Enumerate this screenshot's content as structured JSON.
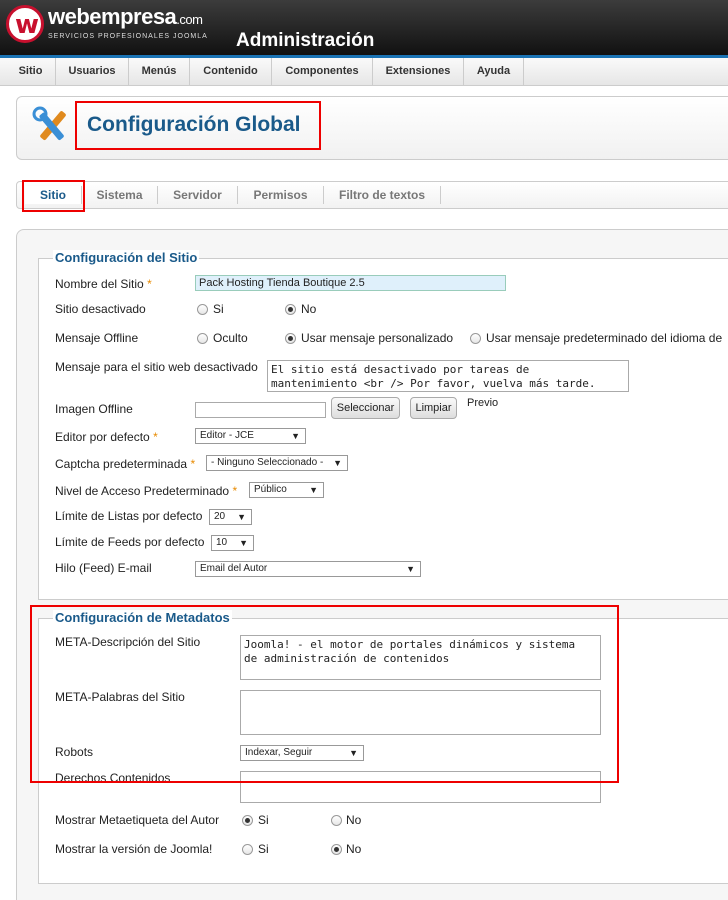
{
  "header": {
    "brand": "webempresa",
    "brand_suffix": ".com",
    "tagline": "SERVICIOS PROFESIONALES JOOMLA",
    "admin_title": "Administración",
    "logo_letter": "w"
  },
  "menu": [
    "Sitio",
    "Usuarios",
    "Menús",
    "Contenido",
    "Componentes",
    "Extensiones",
    "Ayuda"
  ],
  "page_title": "Configuración Global",
  "tabs": [
    "Sitio",
    "Sistema",
    "Servidor",
    "Permisos",
    "Filtro de textos"
  ],
  "site": {
    "legend": "Configuración del Sitio",
    "site_name_label": "Nombre del Sitio",
    "site_name_value": "Pack Hosting Tienda Boutique 2.5",
    "offline_label": "Sitio desactivado",
    "offline_yes": "Si",
    "offline_no": "No",
    "offline_msg_label": "Mensaje Offline",
    "offline_msg_opt1": "Oculto",
    "offline_msg_opt2": "Usar mensaje personalizado",
    "offline_msg_opt3": "Usar mensaje predeterminado del idioma de",
    "offline_text_label": "Mensaje para el sitio web desactivado",
    "offline_text_value": "El sitio está desactivado por tareas de\nmantenimiento <br /> Por favor, vuelva más tarde.",
    "offline_image_label": "Imagen Offline",
    "select_btn": "Seleccionar",
    "clear_btn": "Limpiar",
    "preview": "Previo",
    "editor_label": "Editor por defecto",
    "editor_value": "Editor - JCE",
    "captcha_label": "Captcha predeterminada",
    "captcha_value": "- Ninguno Seleccionado -",
    "access_label": "Nivel de Acceso Predeterminado",
    "access_value": "Público",
    "list_limit_label": "Límite de Listas por defecto",
    "list_limit_value": "20",
    "feed_limit_label": "Límite de Feeds por defecto",
    "feed_limit_value": "10",
    "feed_email_label": "Hilo (Feed) E-mail",
    "feed_email_value": "Email del Autor"
  },
  "meta": {
    "legend": "Configuración de Metadatos",
    "desc_label": "META-Descripción del Sitio",
    "desc_value": "Joomla! - el motor de portales dinámicos y sistema\nde administración de contenidos",
    "keywords_label": "META-Palabras del Sitio",
    "keywords_value": "",
    "robots_label": "Robots",
    "robots_value": "Indexar, Seguir",
    "rights_label": "Derechos Contenidos",
    "rights_value": "",
    "author_label": "Mostrar Metaetiqueta del Autor",
    "author_yes": "Si",
    "author_no": "No",
    "version_label": "Mostrar la versión de Joomla!",
    "version_yes": "Si",
    "version_no": "No"
  },
  "colors": {
    "accent": "#1a5a8a",
    "highlight": "#e00000",
    "brand_red": "#c8102e"
  }
}
